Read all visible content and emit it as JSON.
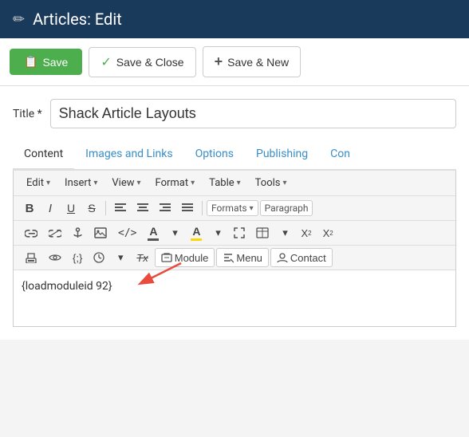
{
  "header": {
    "icon": "✏",
    "title": "Articles: Edit"
  },
  "toolbar": {
    "save_label": "Save",
    "save_close_label": "Save & Close",
    "save_new_label": "Save & New"
  },
  "form": {
    "title_label": "Title *",
    "title_value": "Shack Article Layouts"
  },
  "tabs": [
    {
      "id": "content",
      "label": "Content",
      "active": true
    },
    {
      "id": "images-and-links",
      "label": "Images and Links",
      "active": false
    },
    {
      "id": "options",
      "label": "Options",
      "active": false
    },
    {
      "id": "publishing",
      "label": "Publishing",
      "active": false
    },
    {
      "id": "con",
      "label": "Con",
      "active": false
    }
  ],
  "editor": {
    "menu": [
      {
        "id": "edit",
        "label": "Edit",
        "has_arrow": true
      },
      {
        "id": "insert",
        "label": "Insert",
        "has_arrow": true
      },
      {
        "id": "view",
        "label": "View",
        "has_arrow": true
      },
      {
        "id": "format",
        "label": "Format",
        "has_arrow": true
      },
      {
        "id": "table",
        "label": "Table",
        "has_arrow": true
      },
      {
        "id": "tools",
        "label": "Tools",
        "has_arrow": true
      }
    ],
    "toolbar_row1": {
      "bold": "B",
      "italic": "I",
      "underline": "U",
      "strikethrough": "S",
      "formats_label": "Formats",
      "paragraph_label": "Paragraph"
    },
    "toolbar_row2": {
      "module_label": "Module",
      "menu_label": "Menu",
      "contact_label": "Contact"
    },
    "body_text": "{loadmoduleid 92}"
  }
}
